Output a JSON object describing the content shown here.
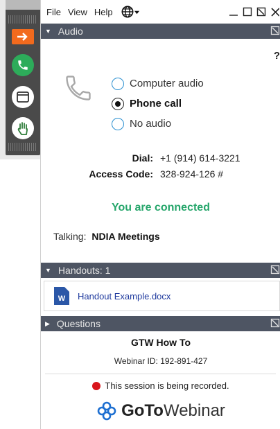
{
  "menu": {
    "file": "File",
    "view": "View",
    "help": "Help"
  },
  "colors": {
    "header_bg": "#4e5563",
    "connected": "#26a66b",
    "record": "#d9161c",
    "accent_blue": "#2a8fd0"
  },
  "toolbar": {
    "icons": [
      "arrow-icon",
      "phone-icon",
      "window-icon",
      "hand-icon"
    ]
  },
  "audio": {
    "header": "Audio",
    "help_mark": "?",
    "options": [
      {
        "label": "Computer audio",
        "selected": false
      },
      {
        "label": "Phone call",
        "selected": true
      },
      {
        "label": "No audio",
        "selected": false
      }
    ],
    "dial_label": "Dial:",
    "dial_value": "+1 (914) 614-3221",
    "access_label": "Access Code:",
    "access_value": "328-924-126 #",
    "status": "You are connected",
    "talking_label": "Talking:",
    "talking_value": "NDIA Meetings"
  },
  "handouts": {
    "header": "Handouts: 1",
    "items": [
      {
        "icon": "W",
        "name": "Handout Example.docx"
      }
    ]
  },
  "questions": {
    "header": "Questions"
  },
  "session": {
    "title": "GTW How To",
    "webinar_id": "Webinar ID: 192-891-427",
    "recording": "This session is being recorded."
  },
  "brand": {
    "goto": "GoTo",
    "webinar": "Webinar"
  }
}
